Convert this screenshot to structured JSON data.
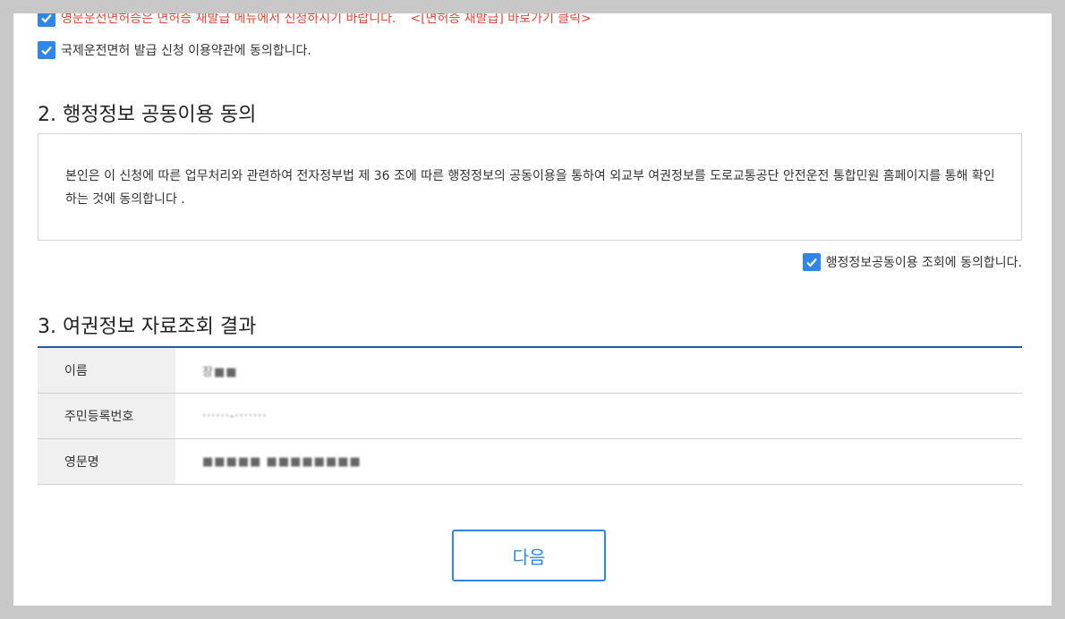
{
  "checks": {
    "english_license_notice": "영문운전면허증은 면허증 재발급 메뉴에서 신청하시기 바랍니다.",
    "reissue_link": "<[면허증 재발급] 바로가기 클릭>",
    "intl_terms_agree": "국제운전면허 발급 신청 이용약관에 동의합니다.",
    "admin_info_agree": "행정정보공동이용 조회에 동의합니다."
  },
  "section2": {
    "title": "2. 행정정보 공동이용 동의",
    "body": "본인은 이 신청에 따른 업무처리와 관련하여 전자정부법 제 36 조에 따른 행정정보의 공동이용을 통하여 외교부 여권정보를 도로교통공단 안전운전 통합민원 홈페이지를 통해 확인하는 것에 동의합니다 ."
  },
  "section3": {
    "title": "3. 여권정보 자료조회 결과",
    "rows": [
      {
        "label": "이름",
        "value": "장■■"
      },
      {
        "label": "주민등록번호",
        "value": "······-·······"
      },
      {
        "label": "영문명",
        "value": "■■■■■ ■■■■■■■■"
      }
    ]
  },
  "next_button": "다음",
  "colors": {
    "accent": "#2f86e8",
    "notice": "#e2483a",
    "table_border": "#1a5ca8"
  }
}
